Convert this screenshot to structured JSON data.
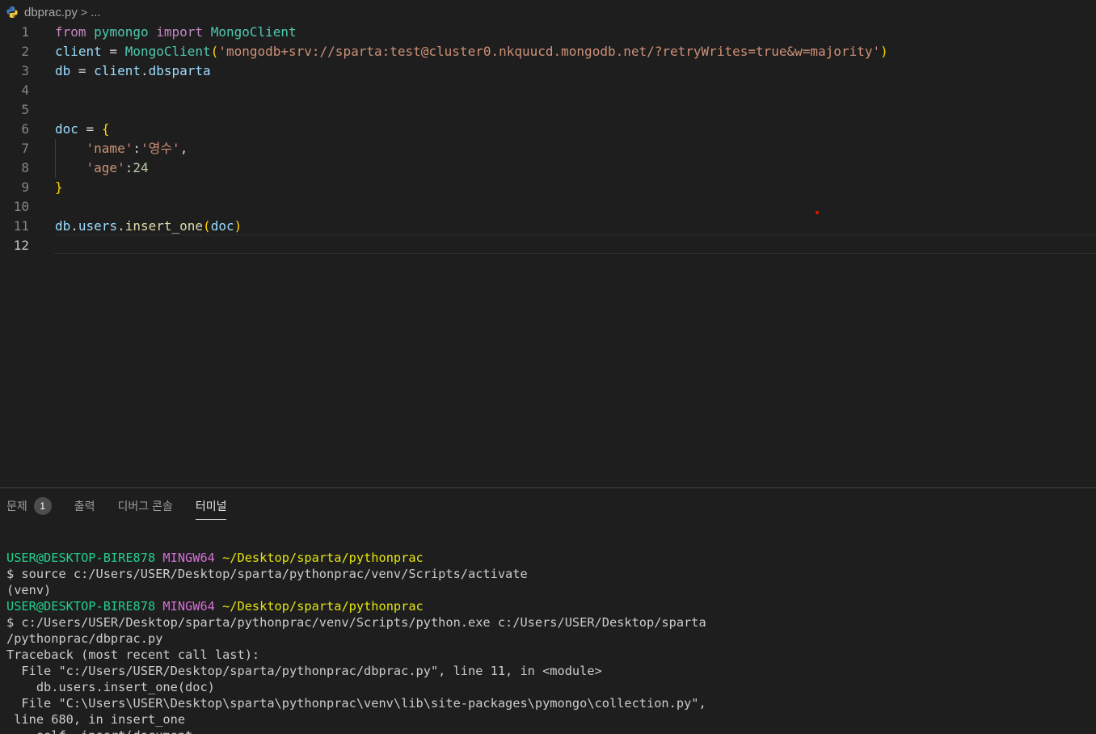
{
  "breadcrumb": {
    "file": "dbprac.py",
    "separator": ">",
    "more": "..."
  },
  "editor": {
    "active_line": 12,
    "lines": [
      {
        "n": "1",
        "tokens": [
          [
            "kw",
            "from"
          ],
          [
            "plain",
            " "
          ],
          [
            "mod",
            "pymongo"
          ],
          [
            "plain",
            " "
          ],
          [
            "kw",
            "import"
          ],
          [
            "plain",
            " "
          ],
          [
            "mod",
            "MongoClient"
          ]
        ]
      },
      {
        "n": "2",
        "tokens": [
          [
            "var",
            "client"
          ],
          [
            "plain",
            " = "
          ],
          [
            "mod",
            "MongoClient"
          ],
          [
            "br1",
            "("
          ],
          [
            "str",
            "'mongodb+srv://sparta:test@cluster0.nkquucd.mongodb.net/?retryWrites=true&w=majority'"
          ],
          [
            "br1",
            ")"
          ]
        ]
      },
      {
        "n": "3",
        "tokens": [
          [
            "var",
            "db"
          ],
          [
            "plain",
            " = "
          ],
          [
            "var",
            "client"
          ],
          [
            "plain",
            "."
          ],
          [
            "var",
            "dbsparta"
          ]
        ]
      },
      {
        "n": "4",
        "tokens": []
      },
      {
        "n": "5",
        "tokens": []
      },
      {
        "n": "6",
        "tokens": [
          [
            "var",
            "doc"
          ],
          [
            "plain",
            " = "
          ],
          [
            "br1",
            "{"
          ]
        ]
      },
      {
        "n": "7",
        "tokens": [
          [
            "plain",
            "    "
          ],
          [
            "str",
            "'name'"
          ],
          [
            "plain",
            ":"
          ],
          [
            "str",
            "'영수'"
          ],
          [
            "plain",
            ","
          ]
        ]
      },
      {
        "n": "8",
        "tokens": [
          [
            "plain",
            "    "
          ],
          [
            "str",
            "'age'"
          ],
          [
            "plain",
            ":"
          ],
          [
            "num",
            "24"
          ]
        ]
      },
      {
        "n": "9",
        "tokens": [
          [
            "br1",
            "}"
          ]
        ]
      },
      {
        "n": "10",
        "tokens": []
      },
      {
        "n": "11",
        "tokens": [
          [
            "var",
            "db"
          ],
          [
            "plain",
            "."
          ],
          [
            "var",
            "users"
          ],
          [
            "plain",
            "."
          ],
          [
            "fn",
            "insert_one"
          ],
          [
            "br1",
            "("
          ],
          [
            "var",
            "doc"
          ],
          [
            "br1",
            ")"
          ]
        ]
      },
      {
        "n": "12",
        "tokens": []
      }
    ]
  },
  "panel": {
    "tabs": [
      {
        "label": "문제",
        "badge": "1",
        "active": false
      },
      {
        "label": "출력",
        "active": false
      },
      {
        "label": "디버그 콘솔",
        "active": false
      },
      {
        "label": "터미널",
        "active": true
      }
    ]
  },
  "terminal": {
    "lines": [
      [
        [
          "t-green",
          "USER@DESKTOP-BIRE878 "
        ],
        [
          "t-magenta",
          "MINGW64 "
        ],
        [
          "t-yellow",
          "~/Desktop/sparta/pythonprac"
        ]
      ],
      [
        [
          "",
          "$ source c:/Users/USER/Desktop/sparta/pythonprac/venv/Scripts/activate"
        ]
      ],
      [
        [
          "",
          "(venv)"
        ]
      ],
      [
        [
          "t-green",
          "USER@DESKTOP-BIRE878 "
        ],
        [
          "t-magenta",
          "MINGW64 "
        ],
        [
          "t-yellow",
          "~/Desktop/sparta/pythonprac"
        ]
      ],
      [
        [
          "",
          "$ c:/Users/USER/Desktop/sparta/pythonprac/venv/Scripts/python.exe c:/Users/USER/Desktop/sparta"
        ]
      ],
      [
        [
          "",
          "/pythonprac/dbprac.py"
        ]
      ],
      [
        [
          "",
          "Traceback (most recent call last):"
        ]
      ],
      [
        [
          "",
          "  File \"c:/Users/USER/Desktop/sparta/pythonprac/dbprac.py\", line 11, in <module>"
        ]
      ],
      [
        [
          "",
          "    db.users.insert_one(doc)"
        ]
      ],
      [
        [
          "",
          "  File \"C:\\Users\\USER\\Desktop\\sparta\\pythonprac\\venv\\lib\\site-packages\\pymongo\\collection.py\","
        ]
      ],
      [
        [
          "",
          " line 680, in insert_one"
        ]
      ],
      [
        [
          "",
          "    self._insert(document,"
        ]
      ]
    ]
  },
  "colors": {
    "background": "#1e1e1e",
    "keyword": "#c586c0",
    "module": "#4ec9b0",
    "variable": "#9cdcfe",
    "string": "#ce9178",
    "terminal_green": "#23d18b",
    "terminal_magenta": "#d670d6",
    "terminal_yellow": "#e5e510"
  }
}
